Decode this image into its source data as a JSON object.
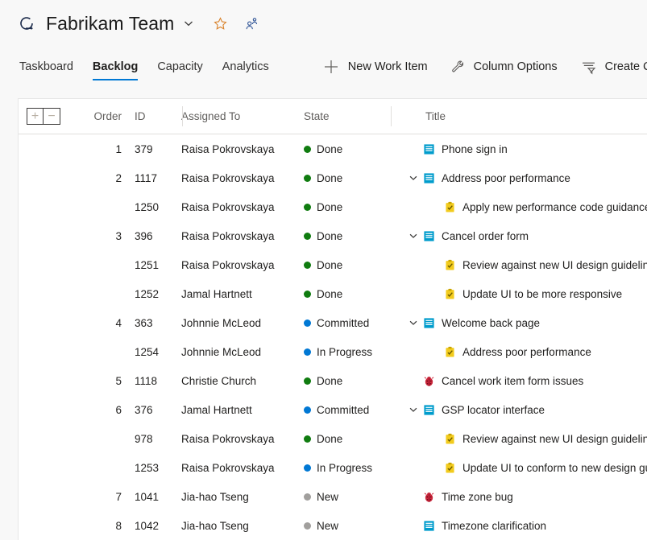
{
  "header": {
    "team_icon": "sprint-refresh-icon",
    "title": "Fabrikam Team",
    "chevron_icon": "chevron-down-icon",
    "favorite_icon": "star-icon",
    "team_members_icon": "people-icon",
    "accent": "#0078d4"
  },
  "tabs": [
    {
      "label": "Taskboard",
      "active": false
    },
    {
      "label": "Backlog",
      "active": true
    },
    {
      "label": "Capacity",
      "active": false
    },
    {
      "label": "Analytics",
      "active": false
    }
  ],
  "toolbar": [
    {
      "label": "New Work Item",
      "icon": "plus-icon"
    },
    {
      "label": "Column Options",
      "icon": "wrench-icon"
    },
    {
      "label": "Create Query",
      "icon": "filter-query-icon"
    }
  ],
  "grid": {
    "expand_all_label": "+",
    "collapse_all_label": "−",
    "columns": [
      "Order",
      "ID",
      "Assigned To",
      "State",
      "Title"
    ],
    "state_colors": {
      "Done": "#107c10",
      "Committed": "#0078d4",
      "In Progress": "#0078d4",
      "New": "#a19f9d"
    },
    "type_colors": {
      "user-story": "#009ccc",
      "task": "#f2cb1d",
      "bug": "#cc293d"
    },
    "rows": [
      {
        "order": "1",
        "id": "379",
        "assigned": "Raisa Pokrovskaya",
        "state": "Done",
        "title": "Phone sign in",
        "type": "user-story",
        "level": 0,
        "expander": "none"
      },
      {
        "order": "2",
        "id": "1117",
        "assigned": "Raisa Pokrovskaya",
        "state": "Done",
        "title": "Address poor performance",
        "type": "user-story",
        "level": 0,
        "expander": "expanded"
      },
      {
        "order": "",
        "id": "1250",
        "assigned": "Raisa Pokrovskaya",
        "state": "Done",
        "title": "Apply new performance code guidance",
        "type": "task",
        "level": 1,
        "expander": "none"
      },
      {
        "order": "3",
        "id": "396",
        "assigned": "Raisa Pokrovskaya",
        "state": "Done",
        "title": "Cancel order form",
        "type": "user-story",
        "level": 0,
        "expander": "expanded"
      },
      {
        "order": "",
        "id": "1251",
        "assigned": "Raisa Pokrovskaya",
        "state": "Done",
        "title": "Review against new UI design guidelines",
        "type": "task",
        "level": 1,
        "expander": "none"
      },
      {
        "order": "",
        "id": "1252",
        "assigned": "Jamal Hartnett",
        "state": "Done",
        "title": "Update UI to be more responsive",
        "type": "task",
        "level": 1,
        "expander": "none"
      },
      {
        "order": "4",
        "id": "363",
        "assigned": "Johnnie McLeod",
        "state": "Committed",
        "title": "Welcome back page",
        "type": "user-story",
        "level": 0,
        "expander": "expanded"
      },
      {
        "order": "",
        "id": "1254",
        "assigned": "Johnnie McLeod",
        "state": "In Progress",
        "title": "Address poor performance",
        "type": "task",
        "level": 1,
        "expander": "none"
      },
      {
        "order": "5",
        "id": "1118",
        "assigned": "Christie Church",
        "state": "Done",
        "title": "Cancel work item form issues",
        "type": "bug",
        "level": 0,
        "expander": "none"
      },
      {
        "order": "6",
        "id": "376",
        "assigned": "Jamal Hartnett",
        "state": "Committed",
        "title": "GSP locator interface",
        "type": "user-story",
        "level": 0,
        "expander": "expanded"
      },
      {
        "order": "",
        "id": "978",
        "assigned": "Raisa Pokrovskaya",
        "state": "Done",
        "title": "Review against new UI design guidelines",
        "type": "task",
        "level": 1,
        "expander": "none"
      },
      {
        "order": "",
        "id": "1253",
        "assigned": "Raisa Pokrovskaya",
        "state": "In Progress",
        "title": "Update UI to conform to new design guidelines",
        "type": "task",
        "level": 1,
        "expander": "none"
      },
      {
        "order": "7",
        "id": "1041",
        "assigned": "Jia-hao Tseng",
        "state": "New",
        "title": "Time zone bug",
        "type": "bug",
        "level": 0,
        "expander": "none"
      },
      {
        "order": "8",
        "id": "1042",
        "assigned": "Jia-hao Tseng",
        "state": "New",
        "title": "Timezone clarification",
        "type": "user-story",
        "level": 0,
        "expander": "none"
      }
    ]
  }
}
